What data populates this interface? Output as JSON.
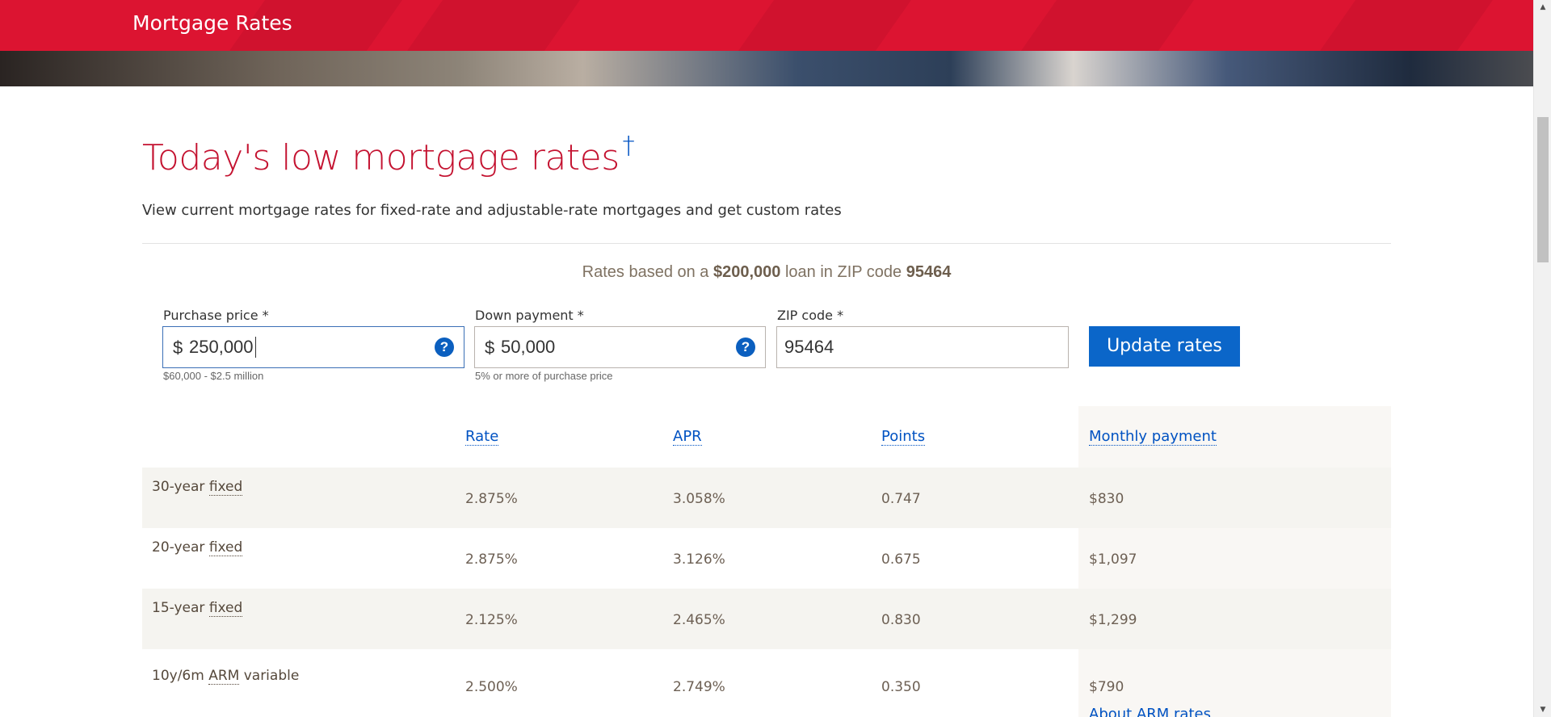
{
  "header": {
    "title": "Mortgage Rates"
  },
  "hero": {
    "heading": "Today's low mortgage rates",
    "dagger": "†",
    "subtitle": "View current mortgage rates for fixed-rate and adjustable-rate mortgages and get custom rates"
  },
  "summary": {
    "prefix": "Rates based on a ",
    "loan": "$200,000",
    "middle": " loan in ZIP code ",
    "zip": "95464"
  },
  "form": {
    "purchase_price": {
      "label": "Purchase price *",
      "prefix": "$",
      "value": "250,000",
      "hint": "$60,000 - $2.5 million",
      "help": "?"
    },
    "down_payment": {
      "label": "Down payment *",
      "prefix": "$",
      "value": "50,000",
      "hint": "5% or more of purchase price",
      "help": "?"
    },
    "zip_code": {
      "label": "ZIP code *",
      "value": "95464"
    },
    "update_label": "Update rates"
  },
  "table": {
    "headers": {
      "rate": "Rate",
      "apr": "APR",
      "points": "Points",
      "monthly": "Monthly payment"
    },
    "rows": [
      {
        "term": "30-year",
        "type": "fixed",
        "suffix": "",
        "rate": "2.875%",
        "apr": "3.058%",
        "points": "0.747",
        "monthly": "$830"
      },
      {
        "term": "20-year",
        "type": "fixed",
        "suffix": "",
        "rate": "2.875%",
        "apr": "3.126%",
        "points": "0.675",
        "monthly": "$1,097"
      },
      {
        "term": "15-year",
        "type": "fixed",
        "suffix": "",
        "rate": "2.125%",
        "apr": "2.465%",
        "points": "0.830",
        "monthly": "$1,299"
      },
      {
        "term": "10y/6m",
        "type": "ARM",
        "suffix": "variable",
        "rate": "2.500%",
        "apr": "2.749%",
        "points": "0.350",
        "monthly": "$790"
      }
    ],
    "arm_link": "About ARM rates"
  },
  "scrollbar": {
    "up": "▲",
    "down": "▼"
  }
}
